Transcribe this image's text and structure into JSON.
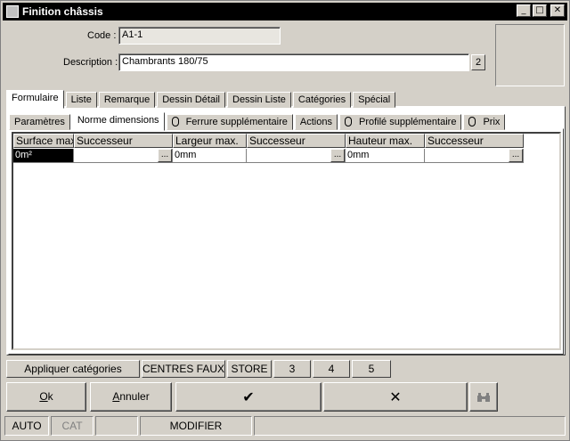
{
  "window": {
    "title": "Finition châssis"
  },
  "form": {
    "code_label": "Code :",
    "code_value": "A1-1",
    "description_label": "Description :",
    "description_value": "Chambrants 180/75",
    "description_lang_button": "2"
  },
  "main_tabs": [
    {
      "label": "Formulaire",
      "active": true
    },
    {
      "label": "Liste",
      "active": false
    },
    {
      "label": "Remarque",
      "active": false
    },
    {
      "label": "Dessin Détail",
      "active": false
    },
    {
      "label": "Dessin Liste",
      "active": false
    },
    {
      "label": "Catégories",
      "active": false
    },
    {
      "label": "Spécial",
      "active": false
    }
  ],
  "sub_tabs": [
    {
      "label": "Paramètres",
      "active": false,
      "attachment": false
    },
    {
      "label": "Norme dimensions",
      "active": true,
      "attachment": false
    },
    {
      "label": "Ferrure supplémentaire",
      "active": false,
      "attachment": true
    },
    {
      "label": "Actions",
      "active": false,
      "attachment": false
    },
    {
      "label": "Profilé supplémentaire",
      "active": false,
      "attachment": true
    },
    {
      "label": "Prix",
      "active": false,
      "attachment": true
    }
  ],
  "grid": {
    "columns": [
      "Surface max.",
      "Successeur",
      "Largeur max.",
      "Successeur",
      "Hauteur max.",
      "Successeur"
    ],
    "rows": [
      [
        "0m²",
        "",
        "0mm",
        "",
        "0mm",
        ""
      ]
    ],
    "ellipsis_label": "..."
  },
  "bottom_buttons": [
    "Appliquer catégories",
    "CENTRES FAUX",
    "STORE",
    "3",
    "4",
    "5"
  ],
  "action_buttons": {
    "ok_prefix": "O",
    "ok_rest": "k",
    "cancel_prefix": "A",
    "cancel_rest": "nnuler",
    "confirm_symbol": "✔",
    "reject_symbol": "✕",
    "search_icon": "binoculars-icon"
  },
  "status_bar": {
    "auto": "AUTO",
    "cat": "CAT",
    "blank": "",
    "mode": "MODIFIER"
  },
  "window_controls": {
    "minimize": "_",
    "maximize": "□",
    "close": "✕"
  }
}
